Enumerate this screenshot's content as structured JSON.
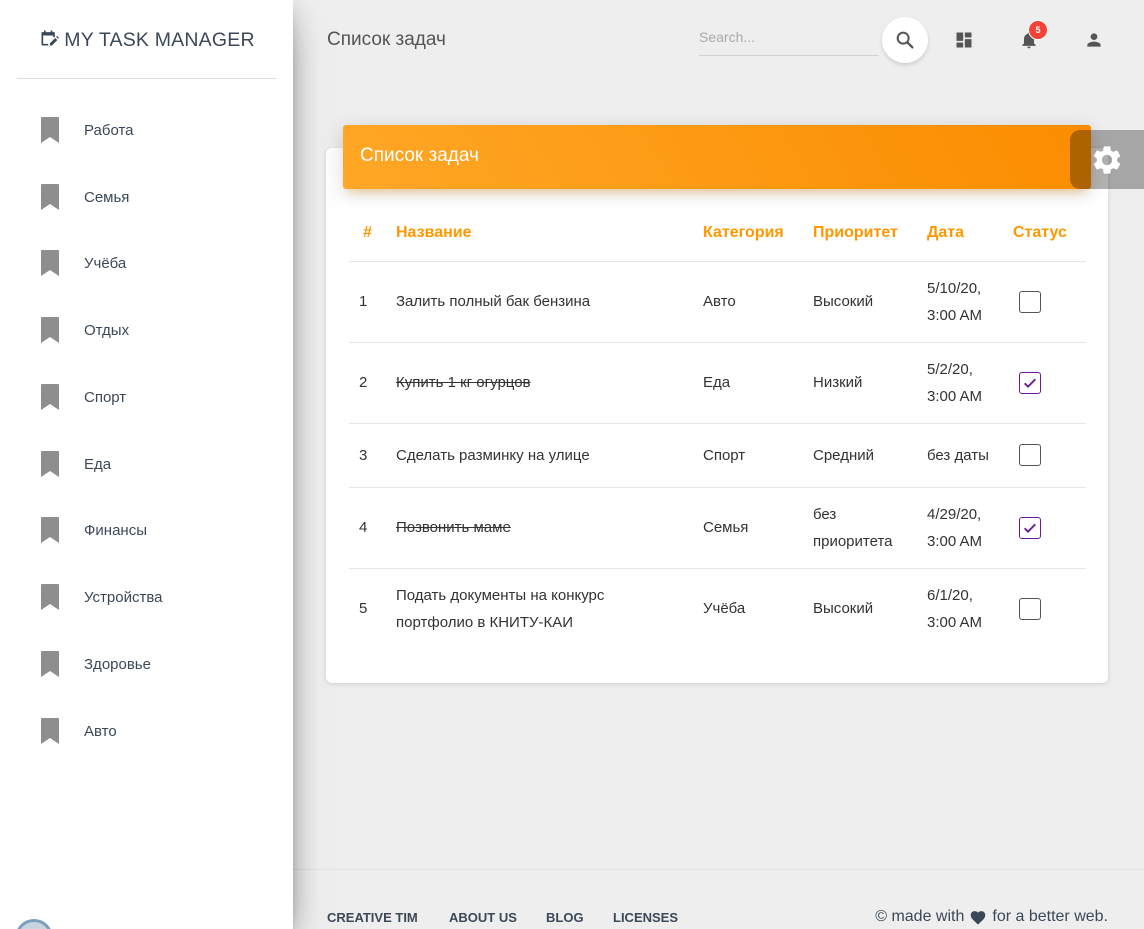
{
  "brand": {
    "title": "MY TASK MANAGER"
  },
  "sidebar": {
    "items": [
      {
        "label": "Работа"
      },
      {
        "label": "Семья"
      },
      {
        "label": "Учёба"
      },
      {
        "label": "Отдых"
      },
      {
        "label": "Спорт"
      },
      {
        "label": "Еда"
      },
      {
        "label": "Финансы"
      },
      {
        "label": "Устройства"
      },
      {
        "label": "Здоровье"
      },
      {
        "label": "Авто"
      }
    ]
  },
  "navbar": {
    "title": "Список задач",
    "search_placeholder": "Search...",
    "notifications_count": "5"
  },
  "card": {
    "title": "Список задач"
  },
  "table": {
    "headers": [
      "#",
      "Название",
      "Категория",
      "Приоритет",
      "Дата",
      "Статус"
    ],
    "rows": [
      {
        "num": "1",
        "name": "Залить полный бак бензина",
        "category": "Авто",
        "priority": "Высокий",
        "date_line1": "5/10/20,",
        "date_line2": "3:00 AM",
        "completed": false
      },
      {
        "num": "2",
        "name": "Купить 1 кг огурцов",
        "category": "Еда",
        "priority": "Низкий",
        "date_line1": "5/2/20,",
        "date_line2": "3:00 AM",
        "completed": true
      },
      {
        "num": "3",
        "name": "Сделать разминку на улице",
        "category": "Спорт",
        "priority": "Средний",
        "date_line1": "без даты",
        "date_line2": "",
        "completed": false
      },
      {
        "num": "4",
        "name": "Позвонить маме",
        "category": "Семья",
        "priority_line1": "без",
        "priority_line2": "приоритета",
        "date_line1": "4/29/20,",
        "date_line2": "3:00 AM",
        "completed": true
      },
      {
        "num": "5",
        "name_line1": "Подать документы на конкурс",
        "name_line2": "портфолио в КНИТУ-КАИ",
        "category": "Учёба",
        "priority": "Высокий",
        "date_line1": "6/1/20,",
        "date_line2": "3:00 AM",
        "completed": false
      }
    ]
  },
  "footer": {
    "links": [
      "CREATIVE TIM",
      "ABOUT US",
      "BLOG",
      "LICENSES"
    ],
    "copyright_prefix": "© made with",
    "copyright_suffix": "for a better web."
  },
  "colors": {
    "accent": "#ff9800",
    "badge": "#f44336",
    "checkbox_checked": "#6a1b9a"
  }
}
